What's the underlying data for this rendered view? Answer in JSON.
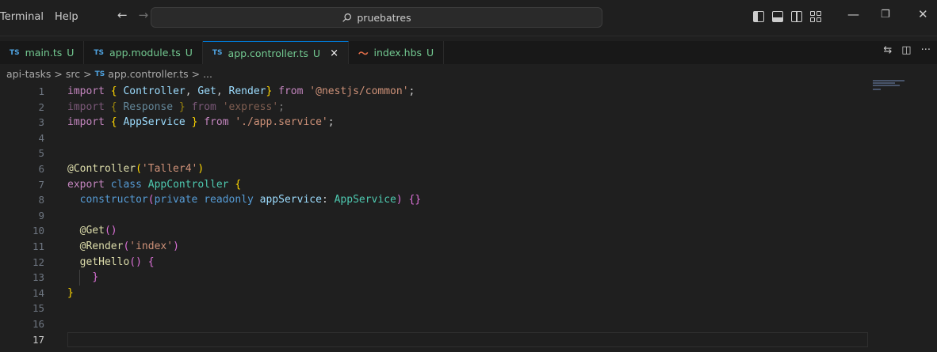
{
  "menu": [
    "Terminal",
    "Help"
  ],
  "search": {
    "text": "pruebatres"
  },
  "tabs": [
    {
      "lang": "TS",
      "name": "main.ts",
      "status": "U",
      "active": false
    },
    {
      "lang": "TS",
      "name": "app.module.ts",
      "status": "U",
      "active": false
    },
    {
      "lang": "TS",
      "name": "app.controller.ts",
      "status": "U",
      "active": true,
      "close": "×"
    },
    {
      "lang": "hbs",
      "name": "index.hbs",
      "status": "U",
      "active": false
    }
  ],
  "breadcrumb": {
    "parts": [
      "api-tasks",
      ">",
      "src",
      ">"
    ],
    "file_lang": "TS",
    "file": "app.controller.ts",
    "tail": "> ..."
  },
  "editor": {
    "line_numbers": [
      "1",
      "2",
      "3",
      "4",
      "5",
      "6",
      "7",
      "8",
      "9",
      "10",
      "11",
      "12",
      "13",
      "14",
      "15",
      "16",
      "17"
    ],
    "current_line": "17"
  },
  "colors": {
    "background": "#1f1f1f",
    "accent": "#0078d4",
    "untracked": "#73c991"
  }
}
